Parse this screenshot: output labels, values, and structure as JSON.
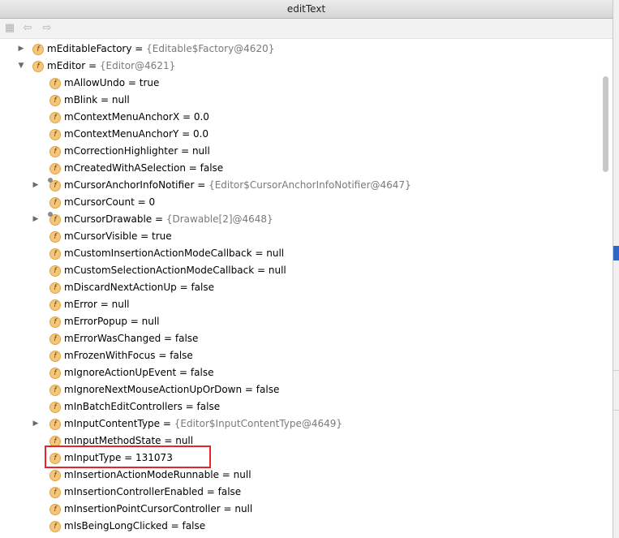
{
  "window": {
    "title": "editText"
  },
  "toolbar": {
    "icons": [
      "stack-icon",
      "back-arrow-icon",
      "forward-arrow-icon"
    ]
  },
  "rows": [
    {
      "indent": 1,
      "expander": "collapsed",
      "name": "mEditableFactory",
      "value": "{Editable$Factory@4620}",
      "object": true
    },
    {
      "indent": 1,
      "expander": "expanded",
      "name": "mEditor",
      "value": "{Editor@4621}",
      "object": true
    },
    {
      "indent": 2,
      "expander": "",
      "name": "mAllowUndo",
      "value": "true",
      "object": false
    },
    {
      "indent": 2,
      "expander": "",
      "name": "mBlink",
      "value": "null",
      "object": false
    },
    {
      "indent": 2,
      "expander": "",
      "name": "mContextMenuAnchorX",
      "value": "0.0",
      "object": false
    },
    {
      "indent": 2,
      "expander": "",
      "name": "mContextMenuAnchorY",
      "value": "0.0",
      "object": false
    },
    {
      "indent": 2,
      "expander": "",
      "name": "mCorrectionHighlighter",
      "value": "null",
      "object": false
    },
    {
      "indent": 2,
      "expander": "",
      "name": "mCreatedWithASelection",
      "value": "false",
      "object": false
    },
    {
      "indent": 2,
      "expander": "collapsed",
      "name": "mCursorAnchorInfoNotifier",
      "value": "{Editor$CursorAnchorInfoNotifier@4647}",
      "object": true,
      "locked": true
    },
    {
      "indent": 2,
      "expander": "",
      "name": "mCursorCount",
      "value": "0",
      "object": false
    },
    {
      "indent": 2,
      "expander": "collapsed",
      "name": "mCursorDrawable",
      "value": "{Drawable[2]@4648}",
      "object": true,
      "locked": true
    },
    {
      "indent": 2,
      "expander": "",
      "name": "mCursorVisible",
      "value": "true",
      "object": false
    },
    {
      "indent": 2,
      "expander": "",
      "name": "mCustomInsertionActionModeCallback",
      "value": "null",
      "object": false
    },
    {
      "indent": 2,
      "expander": "",
      "name": "mCustomSelectionActionModeCallback",
      "value": "null",
      "object": false
    },
    {
      "indent": 2,
      "expander": "",
      "name": "mDiscardNextActionUp",
      "value": "false",
      "object": false
    },
    {
      "indent": 2,
      "expander": "",
      "name": "mError",
      "value": "null",
      "object": false
    },
    {
      "indent": 2,
      "expander": "",
      "name": "mErrorPopup",
      "value": "null",
      "object": false
    },
    {
      "indent": 2,
      "expander": "",
      "name": "mErrorWasChanged",
      "value": "false",
      "object": false
    },
    {
      "indent": 2,
      "expander": "",
      "name": "mFrozenWithFocus",
      "value": "false",
      "object": false
    },
    {
      "indent": 2,
      "expander": "",
      "name": "mIgnoreActionUpEvent",
      "value": "false",
      "object": false
    },
    {
      "indent": 2,
      "expander": "",
      "name": "mIgnoreNextMouseActionUpOrDown",
      "value": "false",
      "object": false
    },
    {
      "indent": 2,
      "expander": "",
      "name": "mInBatchEditControllers",
      "value": "false",
      "object": false
    },
    {
      "indent": 2,
      "expander": "collapsed",
      "name": "mInputContentType",
      "value": "{Editor$InputContentType@4649}",
      "object": true
    },
    {
      "indent": 2,
      "expander": "",
      "name": "mInputMethodState",
      "value": "null",
      "object": false
    },
    {
      "indent": 2,
      "expander": "",
      "name": "mInputType",
      "value": "131073",
      "object": false,
      "highlighted": true
    },
    {
      "indent": 2,
      "expander": "",
      "name": "mInsertionActionModeRunnable",
      "value": "null",
      "object": false
    },
    {
      "indent": 2,
      "expander": "",
      "name": "mInsertionControllerEnabled",
      "value": "false",
      "object": false
    },
    {
      "indent": 2,
      "expander": "",
      "name": "mInsertionPointCursorController",
      "value": "null",
      "object": false
    },
    {
      "indent": 2,
      "expander": "",
      "name": "mIsBeingLongClicked",
      "value": "false",
      "object": false
    }
  ],
  "colors": {
    "highlight_border": "#e3262a",
    "field_icon": "#f4c57a",
    "object_value": "#7a7a7a"
  }
}
